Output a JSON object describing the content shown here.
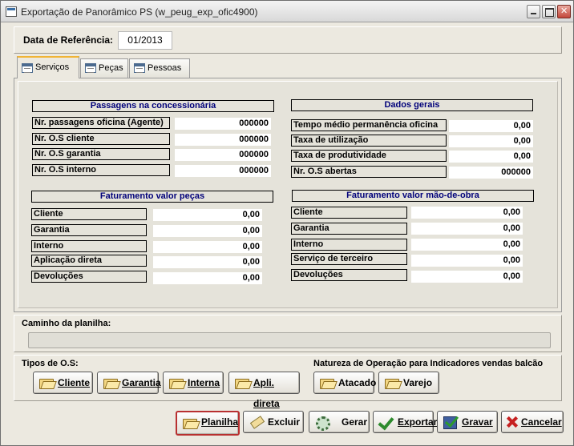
{
  "window": {
    "title": "Exportação de Panorâmico PS (w_peug_exp_ofic4900)"
  },
  "reference": {
    "label": "Data de Referência:",
    "value": "01/2013"
  },
  "tabs": [
    {
      "label": "Serviços",
      "active": true
    },
    {
      "label": "Peças",
      "active": false
    },
    {
      "label": "Pessoas",
      "active": false
    }
  ],
  "passagens": {
    "header": "Passagens na concessionária",
    "rows": [
      {
        "label": "Nr. passagens oficina (Agente)",
        "value": "000000"
      },
      {
        "label": "Nr. O.S cliente",
        "value": "000000"
      },
      {
        "label": "Nr. O.S garantia",
        "value": "000000"
      },
      {
        "label": "Nr. O.S interno",
        "value": "000000"
      }
    ]
  },
  "dados_gerais": {
    "header": "Dados gerais",
    "rows": [
      {
        "label": "Tempo médio permanência oficina",
        "value": "0,00"
      },
      {
        "label": "Taxa de utilização",
        "value": "0,00"
      },
      {
        "label": "Taxa de produtividade",
        "value": "0,00"
      },
      {
        "label": "Nr. O.S abertas",
        "value": "000000"
      }
    ]
  },
  "fat_pecas": {
    "header": "Faturamento valor peças",
    "rows": [
      {
        "label": "Cliente",
        "value": "0,00"
      },
      {
        "label": "Garantia",
        "value": "0,00"
      },
      {
        "label": "Interno",
        "value": "0,00"
      },
      {
        "label": "Aplicação direta",
        "value": "0,00"
      },
      {
        "label": "Devoluções",
        "value": "0,00"
      }
    ]
  },
  "fat_mao_obra": {
    "header": "Faturamento valor mão-de-obra",
    "rows": [
      {
        "label": "Cliente",
        "value": "0,00"
      },
      {
        "label": "Garantia",
        "value": "0,00"
      },
      {
        "label": "Interno",
        "value": "0,00"
      },
      {
        "label": "Serviço de terceiro",
        "value": "0,00"
      },
      {
        "label": "Devoluções",
        "value": "0,00"
      }
    ]
  },
  "path": {
    "label": "Caminho da planilha:",
    "value": ""
  },
  "tipos_os": {
    "label": "Tipos de O.S:",
    "buttons": [
      "Cliente",
      "Garantia",
      "Interna",
      "Apli. direta"
    ]
  },
  "natureza": {
    "label": "Natureza de Operação para Indicadores vendas balcão",
    "buttons": [
      "Atacado",
      "Varejo"
    ]
  },
  "actions": {
    "planilha": "Planilha",
    "excluir": "Excluir",
    "gerar": "Gerar",
    "exportar": "Exportar",
    "gravar": "Gravar",
    "cancelar": "Cancelar"
  },
  "icons": {
    "window": "app-window-icon",
    "tab": "grid-icon",
    "folder": "folder-open-icon",
    "excluir": "eraser-icon",
    "gerar": "gear-icon",
    "exportar": "checkmark-icon",
    "gravar": "save-disk-icon",
    "cancelar": "red-x-icon"
  },
  "colors": {
    "section_header_text": "#00007a",
    "tab_accent": "#f0b436",
    "focused_button_border": "#b83030"
  }
}
